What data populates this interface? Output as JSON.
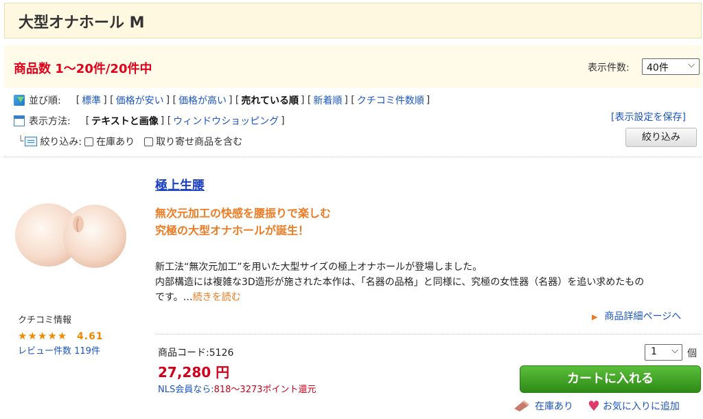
{
  "category": {
    "title": "大型オナホール M"
  },
  "listing": {
    "count_text": "商品数 1〜20件/20件中",
    "per_page_label": "表示件数:",
    "per_page_value": "40件"
  },
  "sort": {
    "label": "並び順:",
    "options": [
      "標準",
      "価格が安い",
      "価格が高い",
      "売れている順",
      "新着順",
      "クチコミ件数順"
    ],
    "current": "売れている順"
  },
  "view": {
    "label": "表示方法:",
    "options": [
      "テキストと画像",
      "ウィンドウショッピング"
    ],
    "current": "テキストと画像",
    "save_label": "[表示設定を保存]"
  },
  "filter": {
    "label": "絞り込み:",
    "in_stock_label": "在庫あり",
    "include_order_label": "取り寄せ商品を含む",
    "button_label": "絞り込み"
  },
  "product": {
    "name": "極上生腰",
    "catch_line1": "無次元加工の快感を腰振りで楽しむ",
    "catch_line2": "究極の大型オナホールが誕生！",
    "desc_line1": "新工法“無次元加工”を用いた大型サイズの極上オナホールが登場しました。",
    "desc_line2": "内部構造には複雑な3D造形が施された本作は、「名器の品格」と同様に、究極の女性器（名器）を追い求めたもの",
    "desc_line3": "です。…",
    "more_label": "続きを読む",
    "detail_label": "商品詳細ページへ",
    "review_label": "クチコミ情報",
    "stars": "★★★★★",
    "rating": "4.61",
    "review_count": "レビュー件数 119件",
    "code_label": "商品コード:",
    "code": "5126",
    "price": "27,280 円",
    "points_prefix": "NLS会員なら:",
    "points_value": "818〜3273ポイント還元",
    "qty_value": "1",
    "qty_unit": "個",
    "cart_label": "カートに入れる",
    "stock_label": "在庫あり",
    "wishlist_label": "お気に入りに追加"
  },
  "colors": {
    "price_red": "#d0001b",
    "catch_orange": "#ee7b22",
    "link_blue": "#1a55c4",
    "cart_green": "#3fa323",
    "header_bg": "#fdf8df"
  }
}
